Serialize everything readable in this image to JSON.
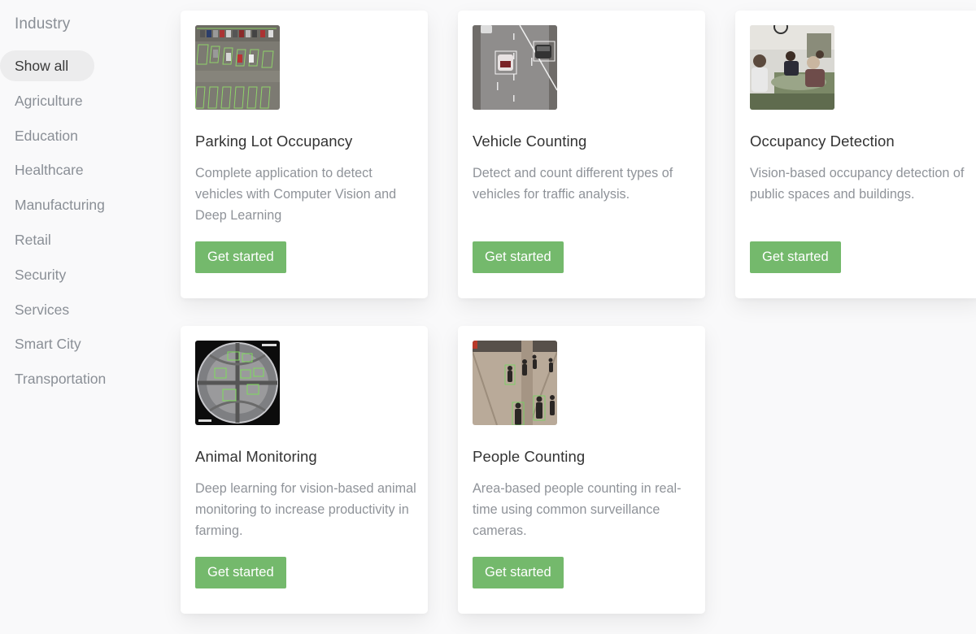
{
  "sidebar": {
    "title": "Industry",
    "items": [
      {
        "label": "Show all",
        "active": true
      },
      {
        "label": "Agriculture"
      },
      {
        "label": "Education"
      },
      {
        "label": "Healthcare"
      },
      {
        "label": "Manufacturing"
      },
      {
        "label": "Retail"
      },
      {
        "label": "Security"
      },
      {
        "label": "Services"
      },
      {
        "label": "Smart City"
      },
      {
        "label": "Transportation"
      }
    ]
  },
  "cards": [
    {
      "title": "Parking Lot Occupancy",
      "description": "Complete application to detect vehicles with Computer Vision and Deep Learning",
      "button": "Get started",
      "image": "parking-lot-aerial-image"
    },
    {
      "title": "Vehicle Counting",
      "description": "Detect and count different types of vehicles for traffic analysis.",
      "button": "Get started",
      "image": "highway-traffic-image"
    },
    {
      "title": "Occupancy Detection",
      "description": "Vision-based occupancy detection of public spaces and buildings.",
      "button": "Get started",
      "image": "office-meeting-image"
    },
    {
      "title": "Animal Monitoring",
      "description": "Deep learning for vision-based animal monitoring to increase productivity in farming.",
      "button": "Get started",
      "image": "fisheye-barn-camera-image"
    },
    {
      "title": "People Counting",
      "description": "Area-based people counting in real-time using common surveillance cameras.",
      "button": "Get started",
      "image": "pedestrian-walkway-image"
    }
  ],
  "colors": {
    "accent_button": "#74b96c",
    "active_filter_bg": "#ececed",
    "page_bg": "#f9f9fa"
  }
}
